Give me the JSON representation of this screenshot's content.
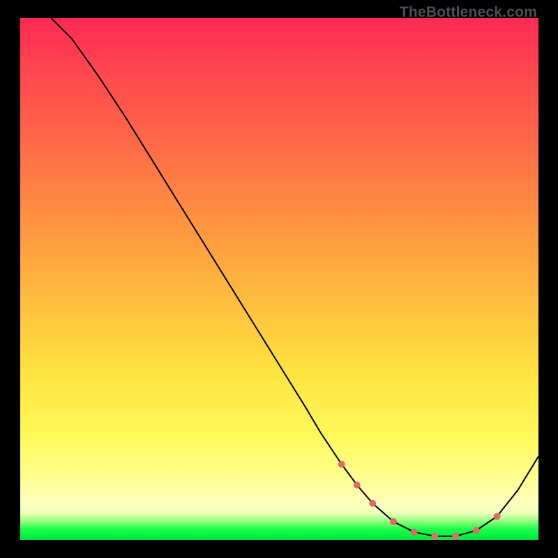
{
  "watermark": "TheBottleneck.com",
  "chart_data": {
    "type": "line",
    "title": "",
    "xlabel": "",
    "ylabel": "",
    "xlim": [
      0,
      100
    ],
    "ylim": [
      0,
      100
    ],
    "grid": false,
    "legend": false,
    "series": [
      {
        "name": "curve",
        "color": "#000000",
        "stroke_width": 2,
        "x": [
          6,
          10,
          15,
          20,
          25,
          30,
          35,
          40,
          45,
          50,
          55,
          58,
          62,
          65,
          68,
          72,
          76,
          80,
          84,
          88,
          92,
          96,
          100
        ],
        "y": [
          100,
          96,
          89,
          81.5,
          73.5,
          65.5,
          57.5,
          49.5,
          41.5,
          33.5,
          25.5,
          20.5,
          14.5,
          10.5,
          7.0,
          3.5,
          1.5,
          0.7,
          0.7,
          1.8,
          4.5,
          9.5,
          16.0
        ]
      },
      {
        "name": "dots",
        "color": "#e06a6a",
        "marker": "dot",
        "marker_r": 5,
        "x": [
          62,
          65,
          68,
          72,
          76,
          80,
          84,
          88,
          92
        ],
        "y": [
          14.5,
          10.5,
          7.0,
          3.5,
          1.5,
          0.7,
          0.7,
          1.8,
          4.5
        ]
      }
    ]
  }
}
